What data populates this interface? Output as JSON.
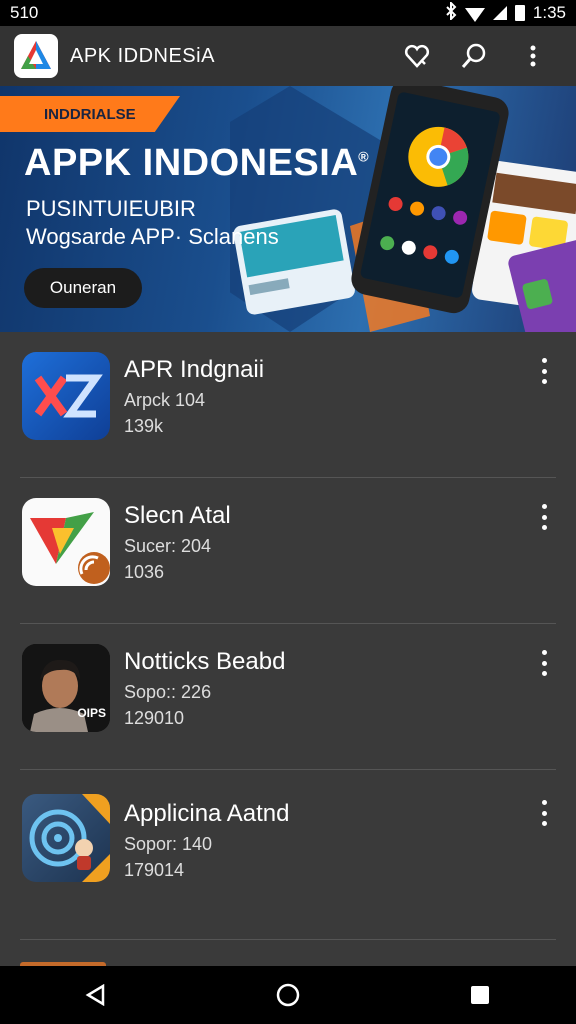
{
  "status_bar": {
    "left_text": "510",
    "time": "1:35"
  },
  "app_bar": {
    "title": "APK IDDNESiA",
    "icons": [
      "heart-icon",
      "search-icon",
      "more-vert-icon"
    ]
  },
  "banner": {
    "tag": "INDDRIALSE",
    "title": "APPK INDONESIA",
    "registered_mark": "®",
    "subtitle1": "PUSINTUIEUBIR",
    "subtitle2": "Wogsarde APP· Sclanens",
    "button_label": "Ouneran"
  },
  "apps": [
    {
      "name": "APR Indgnaii",
      "subtitle": "Arpck 104",
      "count": "139k",
      "icon": "xz-logo-icon"
    },
    {
      "name": "Slecn Atal",
      "subtitle": "Sucer: 204",
      "count": "1036",
      "icon": "triangle-logo-icon"
    },
    {
      "name": "Notticks Beabd",
      "subtitle": "Sopo:: 226",
      "count": "129010",
      "icon": "person-photo-icon",
      "icon_text": "OIPS"
    },
    {
      "name": "Applicina Aatnd",
      "subtitle": "Sopor: 140",
      "count": "179014",
      "icon": "target-cartoon-icon"
    }
  ],
  "colors": {
    "background": "#3a3a3a",
    "app_bar": "#333333",
    "accent_orange": "#ff7a1a",
    "banner_blue": "#1a4e8d"
  }
}
